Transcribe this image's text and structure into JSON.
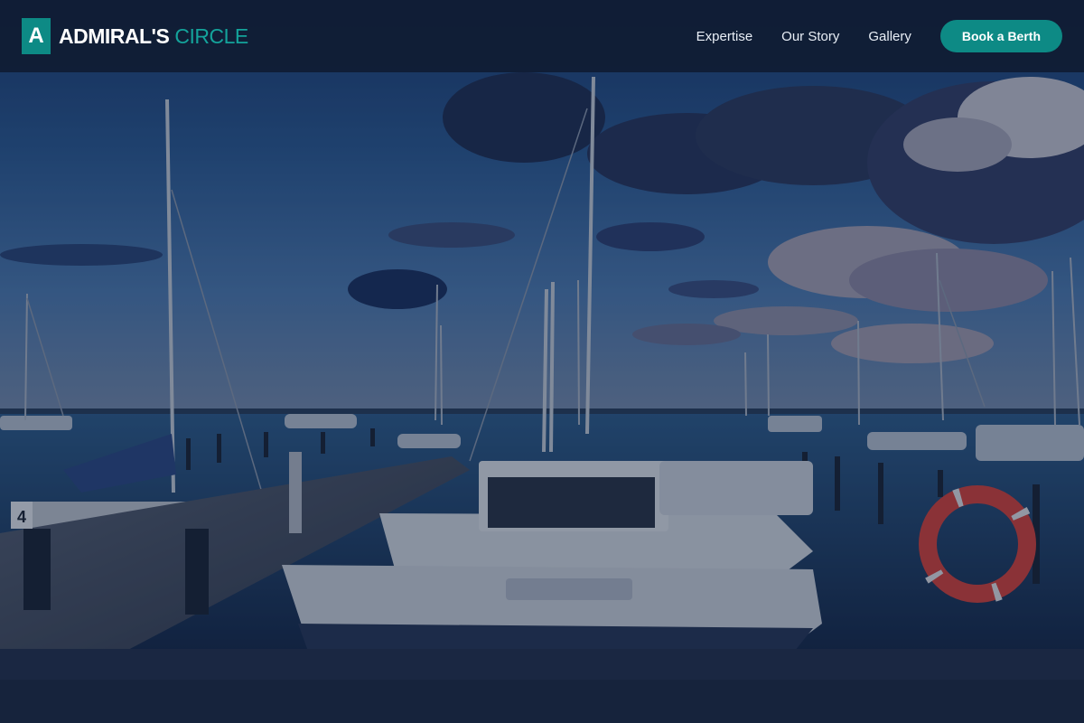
{
  "brand": {
    "mark": "A",
    "name": "ADMIRAL'S",
    "accent": "CIRCLE"
  },
  "nav": {
    "links": [
      {
        "label": "Expertise"
      },
      {
        "label": "Our Story"
      },
      {
        "label": "Gallery"
      }
    ],
    "cta_label": "Book a Berth"
  },
  "hero": {
    "life_ring_number": "4"
  },
  "colors": {
    "navbar_bg": "#101c32",
    "accent": "#0d8a85",
    "accent_text": "#14a39b",
    "nav_text": "#e8eef6"
  }
}
